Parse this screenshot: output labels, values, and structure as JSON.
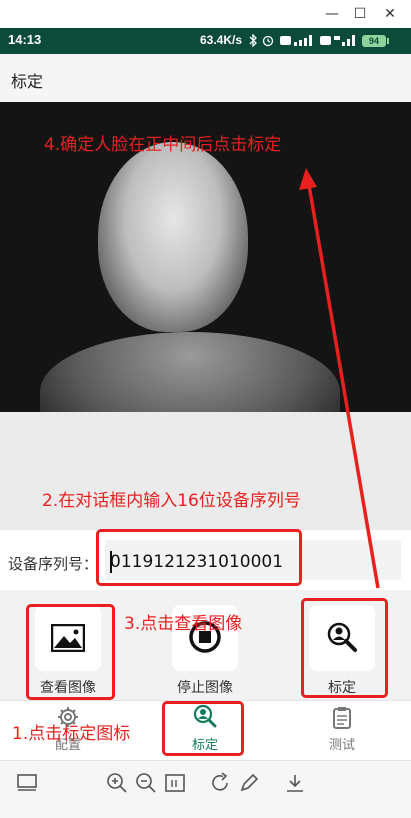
{
  "window": {
    "minimize": "—",
    "maximize": "☐",
    "close": "✕"
  },
  "status_bar": {
    "time": "14:13",
    "speed": "63.4K/s",
    "battery": "94"
  },
  "app_bar": {
    "title": "标定"
  },
  "annotations": {
    "step4": "4.确定人脸在正中间后点击标定",
    "step2": "2.在对话框内输入16位设备序列号",
    "step3": "3.点击查看图像",
    "step1": "1.点击标定图标",
    "color": "#e8201f"
  },
  "serial": {
    "label": "设备序列号：",
    "value": "0119121231010001"
  },
  "actions": {
    "view_image": "查看图像",
    "stop_image": "停止图像",
    "calibrate": "标定"
  },
  "bottom_nav": {
    "config": "配置",
    "calibrate": "标定",
    "test": "测试",
    "active_color": "#0f7a5c"
  }
}
